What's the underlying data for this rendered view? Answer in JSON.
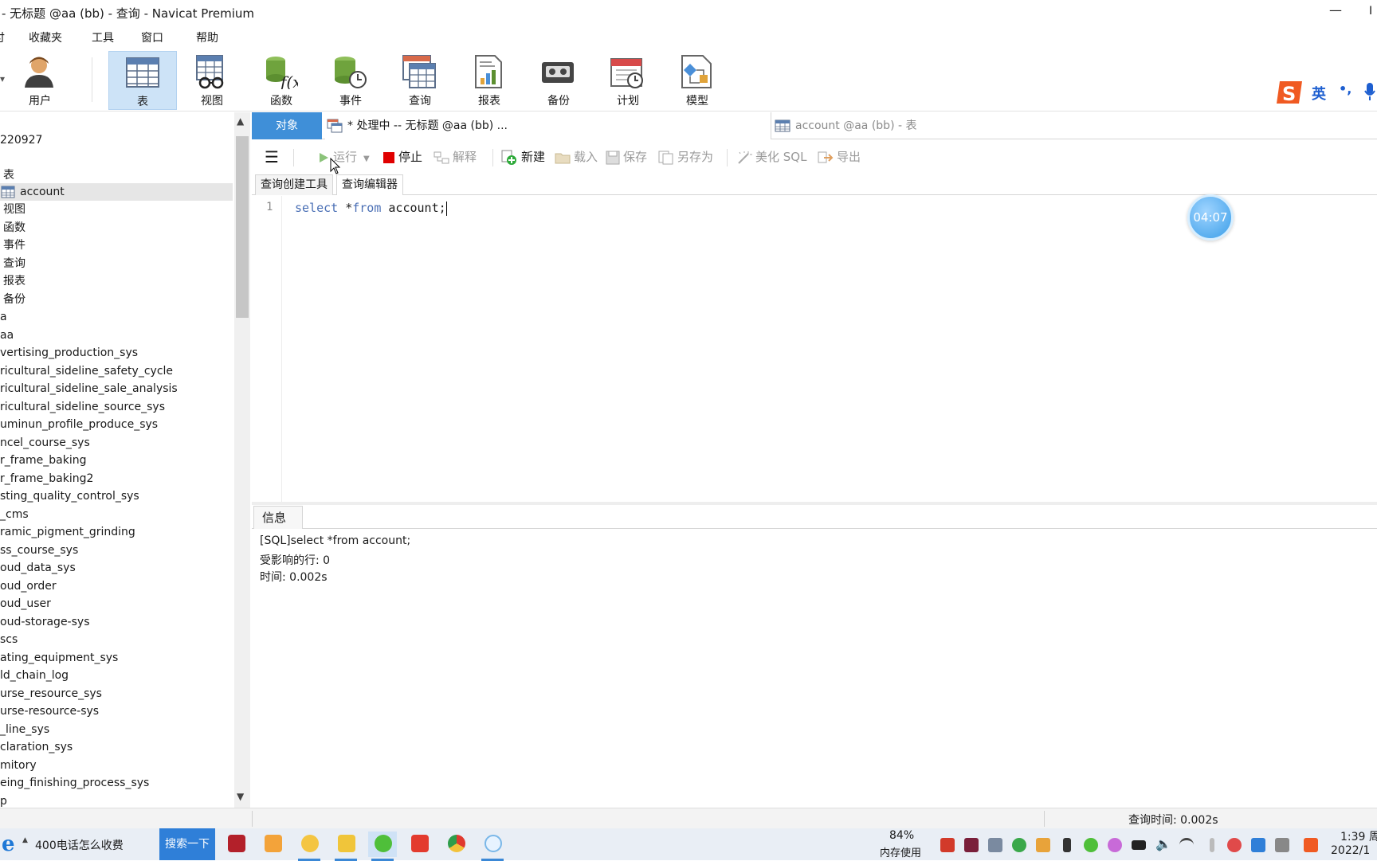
{
  "window": {
    "title": "- 无标题 @aa (bb) - 查询 - Navicat Premium",
    "minimize_glyph": "—",
    "edge_glyph": "I"
  },
  "menu": {
    "items": [
      {
        "label": "付"
      },
      {
        "label": "收藏夹"
      },
      {
        "label": "工具"
      },
      {
        "label": "窗口"
      },
      {
        "label": "帮助"
      }
    ]
  },
  "ribbon": {
    "buttons": [
      {
        "label": "用户",
        "icon": "user-icon"
      },
      {
        "label": "表",
        "icon": "table-icon",
        "active": true
      },
      {
        "label": "视图",
        "icon": "view-icon"
      },
      {
        "label": "函数",
        "icon": "function-icon"
      },
      {
        "label": "事件",
        "icon": "event-icon"
      },
      {
        "label": "查询",
        "icon": "query-icon"
      },
      {
        "label": "报表",
        "icon": "report-icon"
      },
      {
        "label": "备份",
        "icon": "backup-icon"
      },
      {
        "label": "计划",
        "icon": "schedule-icon"
      },
      {
        "label": "模型",
        "icon": "model-icon"
      }
    ]
  },
  "ime": {
    "lang": "英",
    "punct": "•,"
  },
  "tree": {
    "items": [
      {
        "label": "220927"
      },
      {
        "label": "表"
      },
      {
        "label": "account",
        "selected": true
      },
      {
        "label": "视图"
      },
      {
        "label": "函数"
      },
      {
        "label": "事件"
      },
      {
        "label": "查询"
      },
      {
        "label": "报表"
      },
      {
        "label": "备份"
      },
      {
        "label": "a"
      },
      {
        "label": "aa"
      },
      {
        "label": "vertising_production_sys"
      },
      {
        "label": "ricultural_sideline_safety_cycle"
      },
      {
        "label": "ricultural_sideline_sale_analysis"
      },
      {
        "label": "ricultural_sideline_source_sys"
      },
      {
        "label": "uminun_profile_produce_sys"
      },
      {
        "label": "ncel_course_sys"
      },
      {
        "label": "r_frame_baking"
      },
      {
        "label": "r_frame_baking2"
      },
      {
        "label": "sting_quality_control_sys"
      },
      {
        "label": "_cms"
      },
      {
        "label": "ramic_pigment_grinding"
      },
      {
        "label": "ss_course_sys"
      },
      {
        "label": "oud_data_sys"
      },
      {
        "label": "oud_order"
      },
      {
        "label": "oud_user"
      },
      {
        "label": "oud-storage-sys"
      },
      {
        "label": "scs"
      },
      {
        "label": "ating_equipment_sys"
      },
      {
        "label": "ld_chain_log"
      },
      {
        "label": "urse_resource_sys"
      },
      {
        "label": "urse-resource-sys"
      },
      {
        "label": "_line_sys"
      },
      {
        "label": "claration_sys"
      },
      {
        "label": "mitory"
      },
      {
        "label": "eing_finishing_process_sys"
      },
      {
        "label": "p"
      }
    ]
  },
  "tabs": {
    "objects": "对象",
    "query_tab": "* 处理中 -- 无标题 @aa (bb) ...",
    "table_tab": "account @aa (bb) - 表"
  },
  "toolbar": {
    "run": "运行",
    "stop": "停止",
    "explain": "解释",
    "new": "新建",
    "load": "载入",
    "save": "保存",
    "save_as": "另存为",
    "beautify": "美化 SQL",
    "export": "导出"
  },
  "subtabs": {
    "builder": "查询创建工具",
    "editor": "查询编辑器"
  },
  "editor": {
    "line_number": "1",
    "code_kw1": "select",
    "code_mid": " *",
    "code_kw2": "from",
    "code_rest": " account;"
  },
  "timer": "04:07",
  "info": {
    "tab": "信息",
    "lines": [
      "[SQL]select *from account;",
      "受影响的行: 0",
      "时间: 0.002s"
    ]
  },
  "status": {
    "query_time": "查询时间: 0.002s"
  },
  "taskbar": {
    "search_text": "400电话怎么收费",
    "search_button": "搜索一下",
    "memory_percent": "84%",
    "memory_label": "内存使用",
    "clock_time": "1:39 周",
    "clock_date": "2022/1"
  },
  "colors": {
    "accent": "#3f8fd8",
    "ribbon_active": "#cde3f7",
    "keyword": "#4a6fb5"
  }
}
